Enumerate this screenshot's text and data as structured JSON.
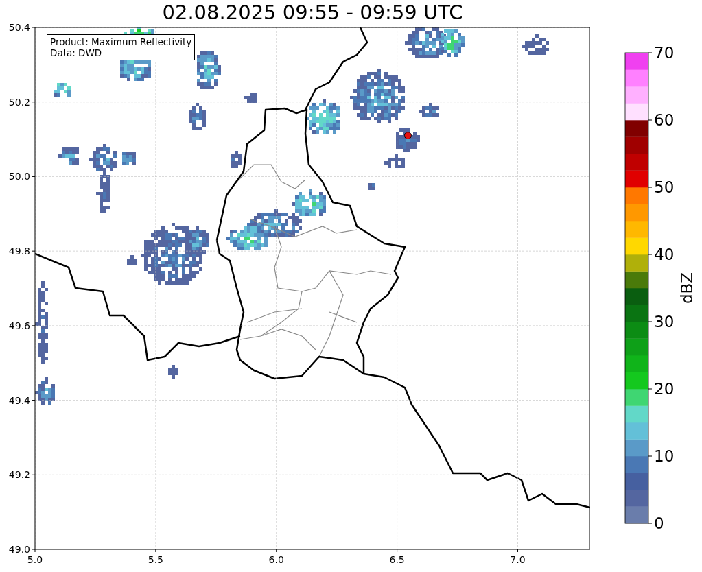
{
  "title": "02.08.2025 09:55 - 09:59 UTC",
  "info_box": {
    "lines": [
      "Product: Maximum Reflectivity",
      "Data: DWD"
    ]
  },
  "map": {
    "chart_data": {
      "type": "scatter",
      "grid": true,
      "xlim": [
        5.0,
        7.3
      ],
      "ylim": [
        49.0,
        50.4
      ],
      "xticks": [
        {
          "value": 5.0,
          "label": "5.0"
        },
        {
          "value": 5.5,
          "label": "5.5"
        },
        {
          "value": 6.0,
          "label": "6.0"
        },
        {
          "value": 6.5,
          "label": "6.5"
        },
        {
          "value": 7.0,
          "label": "7.0"
        }
      ],
      "yticks": [
        {
          "value": 49.0,
          "label": "49.0"
        },
        {
          "value": 49.2,
          "label": "49.2"
        },
        {
          "value": 49.4,
          "label": "49.4"
        },
        {
          "value": 49.6,
          "label": "49.6"
        },
        {
          "value": 49.8,
          "label": "49.8"
        },
        {
          "value": 50.0,
          "label": "50.0"
        },
        {
          "value": 50.2,
          "label": "50.2"
        },
        {
          "value": 50.4,
          "label": "50.4"
        }
      ],
      "x": [
        6.545
      ],
      "series": [
        {
          "color": "#e81010",
          "values": [
            50.11
          ]
        }
      ]
    }
  },
  "colorbar": {
    "label": "dBZ",
    "ticks": [
      "70",
      "60",
      "50",
      "40",
      "30",
      "20",
      "10",
      "0"
    ],
    "bands": [
      {
        "color": "#6a7dab"
      },
      {
        "color": "#5466a0"
      },
      {
        "color": "#4660a0"
      },
      {
        "color": "#4a78b4"
      },
      {
        "color": "#5a9ac8"
      },
      {
        "color": "#63c0d8"
      },
      {
        "color": "#62d8c8"
      },
      {
        "color": "#3fd672"
      },
      {
        "color": "#14c81e"
      },
      {
        "color": "#10b41a"
      },
      {
        "color": "#0ea018"
      },
      {
        "color": "#0c8c14"
      },
      {
        "color": "#0a7412"
      },
      {
        "color": "#0a5e10"
      },
      {
        "color": "#4a7a0a"
      },
      {
        "color": "#b0b00a"
      },
      {
        "color": "#ffd800"
      },
      {
        "color": "#ffb800"
      },
      {
        "color": "#ff9800"
      },
      {
        "color": "#ff7800"
      },
      {
        "color": "#e00000"
      },
      {
        "color": "#c00000"
      },
      {
        "color": "#a00000"
      },
      {
        "color": "#800000"
      },
      {
        "color": "#ffe0ff"
      },
      {
        "color": "#ffb0ff"
      },
      {
        "color": "#ff80ff"
      },
      {
        "color": "#f040f0"
      }
    ]
  }
}
